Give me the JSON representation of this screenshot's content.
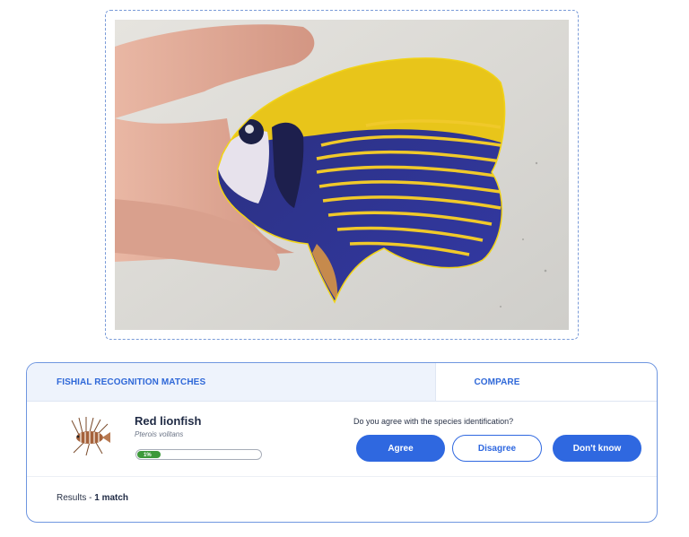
{
  "photo": {
    "subject": "fish-photo",
    "outline_color": "#f1d317"
  },
  "panel": {
    "tabs": [
      {
        "label": "FISHIAL RECOGNITION MATCHES",
        "active": true
      },
      {
        "label": "COMPARE",
        "active": false
      }
    ],
    "match": {
      "common_name": "Red lionfish",
      "latin_name": "Pterois volitans",
      "confidence_label": "1%",
      "confidence": 1,
      "question": "Do you agree with the species identification?",
      "buttons": {
        "agree": "Agree",
        "disagree": "Disagree",
        "dont_know": "Don't know"
      }
    },
    "results": {
      "prefix": "Results - ",
      "count": "1 match"
    }
  },
  "colors": {
    "accent": "#2f68e0",
    "progress": "#3d9a3a",
    "border": "#6f96e0"
  }
}
